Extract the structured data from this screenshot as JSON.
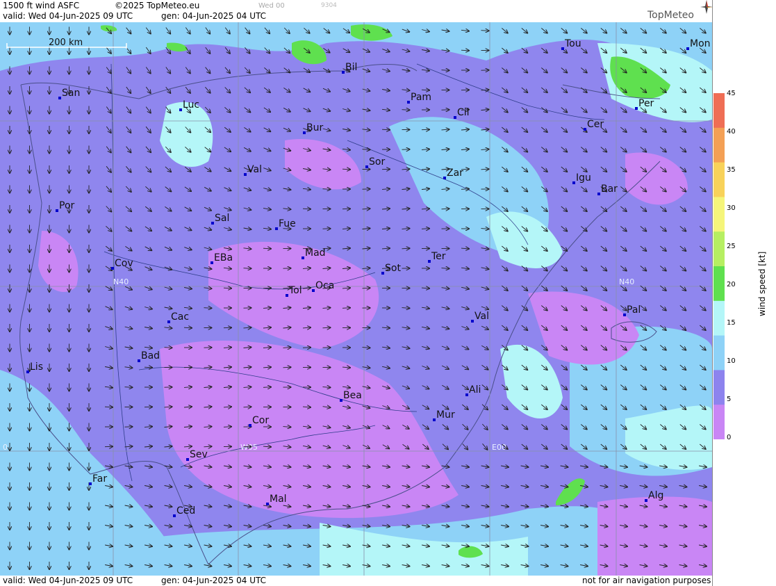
{
  "header": {
    "product": "1500 ft wind ASFC",
    "copyright": "©2025 TopMeteo.eu",
    "valid": "valid:  Wed  04-Jun-2025  09 UTC",
    "gen": "gen: 04-Jun-2025 04 UTC",
    "faint1": "Wed 00",
    "faint2": "9304",
    "logo": "TopMeteo"
  },
  "footer": {
    "valid": "valid:  Wed  04-Jun-2025  09 UTC",
    "gen": "gen: 04-Jun-2025 04 UTC",
    "disclaimer": "not for air navigation purposes"
  },
  "scale_bar": {
    "label": "200 km"
  },
  "grid_labels": [
    "N40",
    "N40",
    "W05",
    "E00",
    "0"
  ],
  "cities": [
    {
      "name": "Bil"
    },
    {
      "name": "Tou"
    },
    {
      "name": "Mon"
    },
    {
      "name": "San"
    },
    {
      "name": "Pam"
    },
    {
      "name": "Luc"
    },
    {
      "name": "Cil"
    },
    {
      "name": "Per"
    },
    {
      "name": "Bur"
    },
    {
      "name": "Cer"
    },
    {
      "name": "Sor"
    },
    {
      "name": "Val"
    },
    {
      "name": "Zar"
    },
    {
      "name": "Igu"
    },
    {
      "name": "Bar"
    },
    {
      "name": "Por"
    },
    {
      "name": "Sal"
    },
    {
      "name": "Fue"
    },
    {
      "name": "Mad"
    },
    {
      "name": "Ter"
    },
    {
      "name": "Cov"
    },
    {
      "name": "EBa"
    },
    {
      "name": "Sot"
    },
    {
      "name": "Tol"
    },
    {
      "name": "Oca"
    },
    {
      "name": "Cac"
    },
    {
      "name": "Val"
    },
    {
      "name": "Pal"
    },
    {
      "name": "Bad"
    },
    {
      "name": "Lis"
    },
    {
      "name": "Ali"
    },
    {
      "name": "Bea"
    },
    {
      "name": "Mur"
    },
    {
      "name": "Cor"
    },
    {
      "name": "Sev"
    },
    {
      "name": "Far"
    },
    {
      "name": "Mal"
    },
    {
      "name": "Alg"
    },
    {
      "name": "Ced"
    }
  ],
  "legend": {
    "title": "wind speed  [kt]",
    "ticks": [
      "45",
      "40",
      "35",
      "30",
      "25",
      "20",
      "15",
      "10",
      "5",
      "0"
    ],
    "colors": [
      "#ef6e55",
      "#f4a055",
      "#f8d25a",
      "#f5f57a",
      "#b6ef62",
      "#5fe04f",
      "#b4f6f8",
      "#8ed2f7",
      "#8d83ee",
      "#c986f5"
    ]
  }
}
